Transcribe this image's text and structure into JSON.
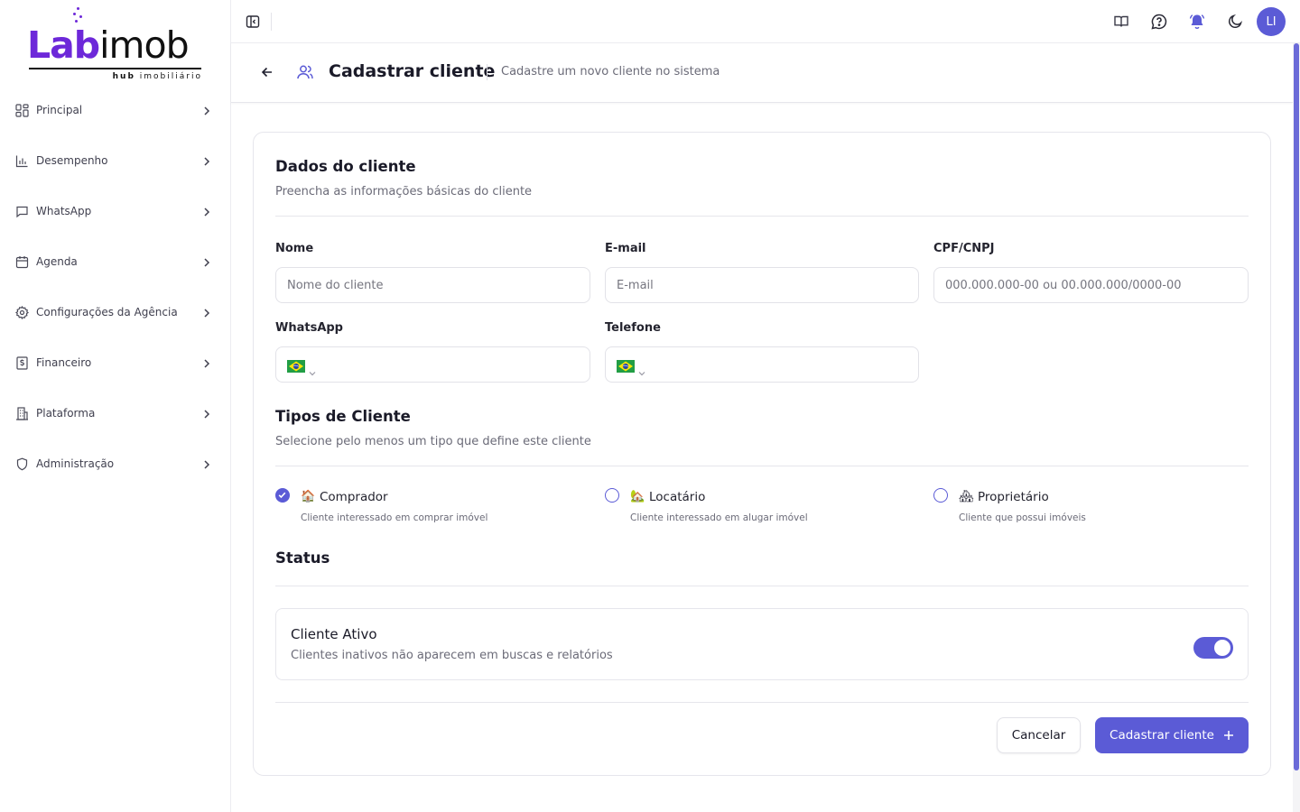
{
  "brand": {
    "logo_prefix": "Lab",
    "logo_suffix": "imob",
    "logo_sub_bold": "hub",
    "logo_sub_rest": "imobiliário",
    "accent_color": "#5b5bd6",
    "logo_color": "#6d28d9"
  },
  "sidebar": {
    "items": [
      {
        "label": "Principal",
        "icon": "grid-icon"
      },
      {
        "label": "Desempenho",
        "icon": "bar-chart-icon"
      },
      {
        "label": "WhatsApp",
        "icon": "message-icon"
      },
      {
        "label": "Agenda",
        "icon": "calendar-icon"
      },
      {
        "label": "Configurações da Agência",
        "icon": "gear-icon"
      },
      {
        "label": "Financeiro",
        "icon": "dollar-file-icon"
      },
      {
        "label": "Plataforma",
        "icon": "building-icon"
      },
      {
        "label": "Administração",
        "icon": "shield-icon"
      }
    ]
  },
  "topbar": {
    "icons": [
      "book-icon",
      "help-chat-icon",
      "bell-icon",
      "moon-icon"
    ],
    "avatar_initials": "LI"
  },
  "header": {
    "title": "Cadastrar cliente",
    "subtitle": "Cadastre um novo cliente no sistema"
  },
  "form": {
    "section_client": {
      "title": "Dados do cliente",
      "subtitle": "Preencha as informações básicas do cliente"
    },
    "fields": {
      "name": {
        "label": "Nome",
        "placeholder": "Nome do cliente",
        "value": ""
      },
      "email": {
        "label": "E-mail",
        "placeholder": "E-mail",
        "value": ""
      },
      "doc": {
        "label": "CPF/CNPJ",
        "placeholder": "000.000.000-00 ou 00.000.000/0000-00",
        "value": ""
      },
      "whatsapp": {
        "label": "WhatsApp",
        "country": "BR",
        "value": ""
      },
      "phone": {
        "label": "Telefone",
        "country": "BR",
        "value": ""
      }
    },
    "section_types": {
      "title": "Tipos de Cliente",
      "subtitle": "Selecione pelo menos um tipo que define este cliente"
    },
    "types": [
      {
        "emoji": "🏠",
        "label": "Comprador",
        "desc": "Cliente interessado em comprar imóvel",
        "checked": true
      },
      {
        "emoji": "🏡",
        "label": "Locatário",
        "desc": "Cliente interessado em alugar imóvel",
        "checked": false
      },
      {
        "emoji": "🏘",
        "label": "Proprietário",
        "desc": "Cliente que possui imóveis",
        "checked": false
      }
    ],
    "section_status": {
      "title": "Status"
    },
    "status": {
      "title": "Cliente Ativo",
      "desc": "Clientes inativos não aparecem em buscas e relatórios",
      "active": true
    },
    "actions": {
      "cancel": "Cancelar",
      "submit": "Cadastrar cliente"
    }
  }
}
